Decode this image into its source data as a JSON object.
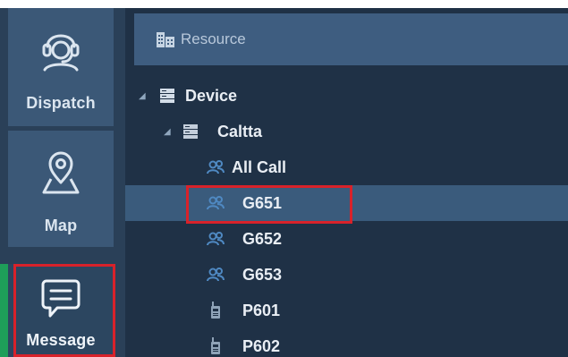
{
  "nav": {
    "dispatch_label": "Dispatch",
    "map_label": "Map",
    "message_label": "Message"
  },
  "resource": {
    "title": "Resource"
  },
  "tree": {
    "device": "Device",
    "group": "Caltta",
    "items": [
      "All Call",
      "G651",
      "G652",
      "G653",
      "P601",
      "P602"
    ],
    "selected": "G651"
  },
  "colors": {
    "background": "#1f3146",
    "nav_item": "#3b5877",
    "selected_row": "#3a5b7c",
    "highlight_box": "#d8222a",
    "active_indicator": "#1e9e59",
    "talkgroup_icon": "#4f89c2"
  },
  "icons": {
    "dispatch": "headset-person-icon",
    "map": "map-pin-icon",
    "message": "chat-bubble-icon",
    "resource": "building-icon",
    "device": "server-icon",
    "group": "server-icon",
    "talkgroup": "talkgroup-icon",
    "radio": "radio-icon"
  }
}
